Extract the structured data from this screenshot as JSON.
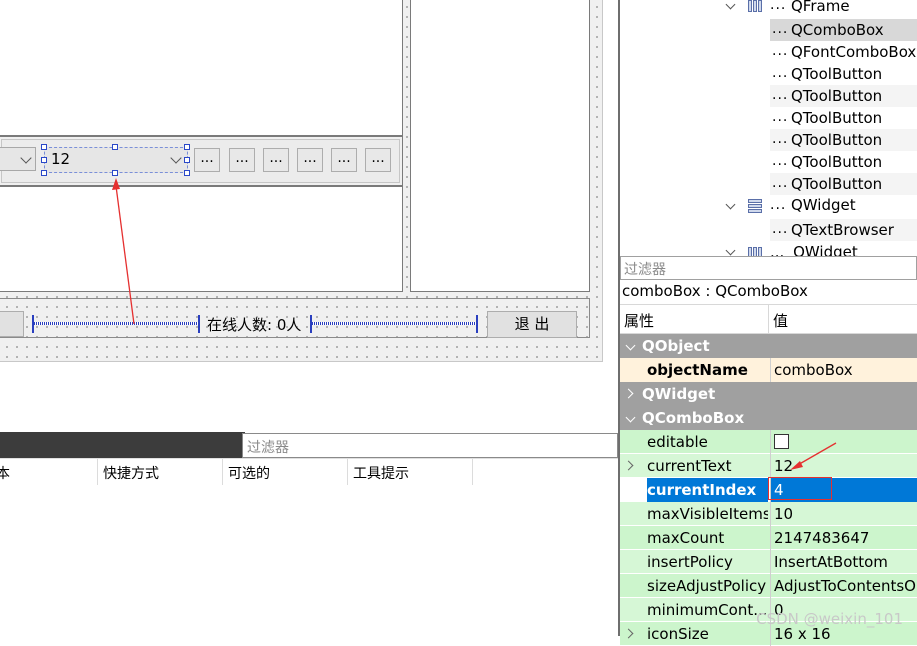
{
  "form": {
    "combo_left_value": "",
    "combo_value": "12",
    "tool_buttons": [
      "...",
      "...",
      "...",
      "...",
      "...",
      "..."
    ],
    "online_label": "在线人数: 0人",
    "exit_button": "退 出"
  },
  "action_editor": {
    "filter_placeholder": "过滤器",
    "columns": [
      "本",
      "快捷方式",
      "可选的",
      "工具提示"
    ]
  },
  "object_inspector": {
    "tree": [
      {
        "label": "QFrame",
        "dots": "...",
        "icon": "frame-icon",
        "expanded": true
      },
      {
        "label": "QComboBox",
        "dots": "...",
        "selected": true
      },
      {
        "label": "QFontComboBox",
        "dots": "..."
      },
      {
        "label": "QToolButton",
        "dots": "..."
      },
      {
        "label": "QToolButton",
        "dots": "..."
      },
      {
        "label": "QToolButton",
        "dots": "..."
      },
      {
        "label": "QToolButton",
        "dots": "..."
      },
      {
        "label": "QToolButton",
        "dots": "..."
      },
      {
        "label": "QToolButton",
        "dots": "..."
      },
      {
        "label": "QWidget",
        "dots": "...",
        "icon": "widget-icon",
        "expanded": true
      },
      {
        "label": "QTextBrowser",
        "dots": "..."
      },
      {
        "label": "QWidget",
        "dots": "...",
        "icon": "frame-icon",
        "expanded": true
      }
    ]
  },
  "property_editor": {
    "filter_placeholder": "过滤器",
    "object_title": "comboBox : QComboBox",
    "col_property": "属性",
    "col_value": "值",
    "rows": [
      {
        "type": "group",
        "key": "QObject",
        "expanded": true
      },
      {
        "type": "prop",
        "key": "objectName",
        "value": "comboBox",
        "bold": true,
        "style": "peach"
      },
      {
        "type": "group",
        "key": "QWidget",
        "expanded": false
      },
      {
        "type": "group",
        "key": "QComboBox",
        "expanded": true
      },
      {
        "type": "prop",
        "key": "editable",
        "value": "",
        "checkbox": true,
        "checked": false,
        "style": "green"
      },
      {
        "type": "prop",
        "key": "currentText",
        "value": "12",
        "expandable": true,
        "style": "green2"
      },
      {
        "type": "prop",
        "key": "currentIndex",
        "value": "4",
        "bold": true,
        "style": "selected"
      },
      {
        "type": "prop",
        "key": "maxVisibleItems",
        "value": "10",
        "style": "green2"
      },
      {
        "type": "prop",
        "key": "maxCount",
        "value": "2147483647",
        "style": "green"
      },
      {
        "type": "prop",
        "key": "insertPolicy",
        "value": "InsertAtBottom",
        "style": "green2"
      },
      {
        "type": "prop",
        "key": "sizeAdjustPolicy",
        "value": "AdjustToContentsOn",
        "style": "green"
      },
      {
        "type": "prop",
        "key": "minimumCont...",
        "value": "0",
        "style": "green2"
      },
      {
        "type": "prop",
        "key": "iconSize",
        "value": "16 x 16",
        "expandable": true,
        "style": "green"
      }
    ]
  },
  "watermark": "CSDN @weixin_101",
  "colors": {
    "selection": "#0078d7",
    "property_green": "#ccf5cc",
    "annotation_red": "#e53030",
    "handle_blue": "#2a48c8"
  }
}
